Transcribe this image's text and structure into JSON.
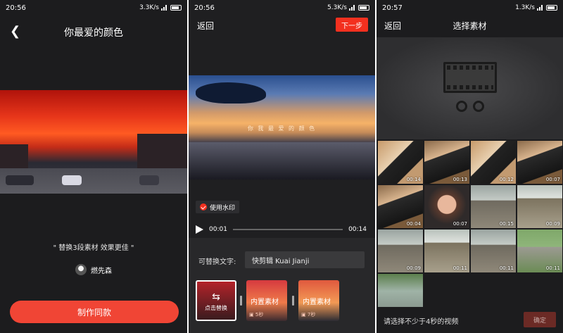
{
  "screen1": {
    "status": {
      "time": "20:56",
      "speed": "3.3K/s"
    },
    "title": "你最爱的颜色",
    "slogan": "\" 替换3段素材 效果更佳 \"",
    "author": "燃先森",
    "make_button": "制作同款"
  },
  "screen2": {
    "status": {
      "time": "20:56",
      "speed": "5.3K/s"
    },
    "back_label": "返回",
    "next_label": "下一步",
    "video_caption": "你 我 最 爱 的 颜 色",
    "watermark_label": "使用水印",
    "watermark_checked": true,
    "player": {
      "current": "00:01",
      "total": "00:14"
    },
    "replace_text_label": "可替换文字:",
    "replace_text_value": "快剪辑 Kuai Jianji",
    "clips": [
      {
        "label": "点击替换",
        "selected": true
      },
      {
        "label": "内置素材",
        "duration": "5秒"
      },
      {
        "label": "内置素材",
        "duration": "7秒"
      }
    ]
  },
  "screen3": {
    "status": {
      "time": "20:57",
      "speed": "1.3K/s"
    },
    "back_label": "返回",
    "title": "选择素材",
    "thumbnails": [
      {
        "duration": "00:14",
        "style": "c-door"
      },
      {
        "duration": "00:13",
        "style": "c-door2"
      },
      {
        "duration": "00:12",
        "style": "c-door"
      },
      {
        "duration": "00:07",
        "style": "c-door2"
      },
      {
        "duration": "00:04",
        "style": "c-door2"
      },
      {
        "duration": "00:07",
        "style": "c-face"
      },
      {
        "duration": "00:15",
        "style": "c-pav"
      },
      {
        "duration": "00:09",
        "style": "c-pav2"
      },
      {
        "duration": "00:09",
        "style": "c-pav"
      },
      {
        "duration": "00:11",
        "style": "c-pav2"
      },
      {
        "duration": "00:11",
        "style": "c-pav"
      },
      {
        "duration": "00:11",
        "style": "c-park"
      },
      {
        "duration": "00:11",
        "style": "c-road"
      }
    ],
    "footer_hint": "请选择不少于4秒的视频",
    "confirm_label": "确定"
  }
}
